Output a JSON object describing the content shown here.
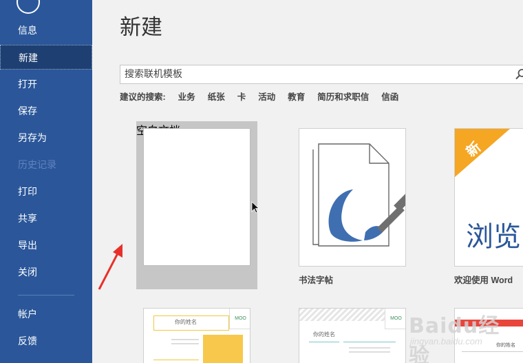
{
  "sidebar": {
    "items": [
      {
        "label": "信息"
      },
      {
        "label": "新建"
      },
      {
        "label": "打开"
      },
      {
        "label": "保存"
      },
      {
        "label": "另存为"
      },
      {
        "label": "历史记录"
      },
      {
        "label": "打印"
      },
      {
        "label": "共享"
      },
      {
        "label": "导出"
      },
      {
        "label": "关闭"
      },
      {
        "label": "帐户"
      },
      {
        "label": "反馈"
      }
    ]
  },
  "main": {
    "title": "新建",
    "search": {
      "placeholder": "搜索联机模板"
    },
    "suggested": {
      "label": "建议的搜索:",
      "keywords": [
        "业务",
        "纸张",
        "卡",
        "活动",
        "教育",
        "简历和求职信",
        "信函"
      ]
    },
    "templates": [
      {
        "name": "空白文档"
      },
      {
        "name": "书法字帖"
      },
      {
        "name": "欢迎使用 Word",
        "badge": "新",
        "preview_text": "浏览"
      }
    ],
    "resume_cards": [
      {
        "heading": "你的姓名",
        "logo": "MOO"
      },
      {
        "heading": "你的姓名",
        "logo": "MOO"
      },
      {
        "heading": "你的姓名"
      }
    ]
  },
  "watermark": {
    "brand": "Baidu经验",
    "url": "jingyan.baidu.com"
  },
  "colors": {
    "sidebar": "#2b579a",
    "sidebar_active": "#1e3f71",
    "badge": "#f5a623",
    "accent_red": "#e8453c"
  }
}
